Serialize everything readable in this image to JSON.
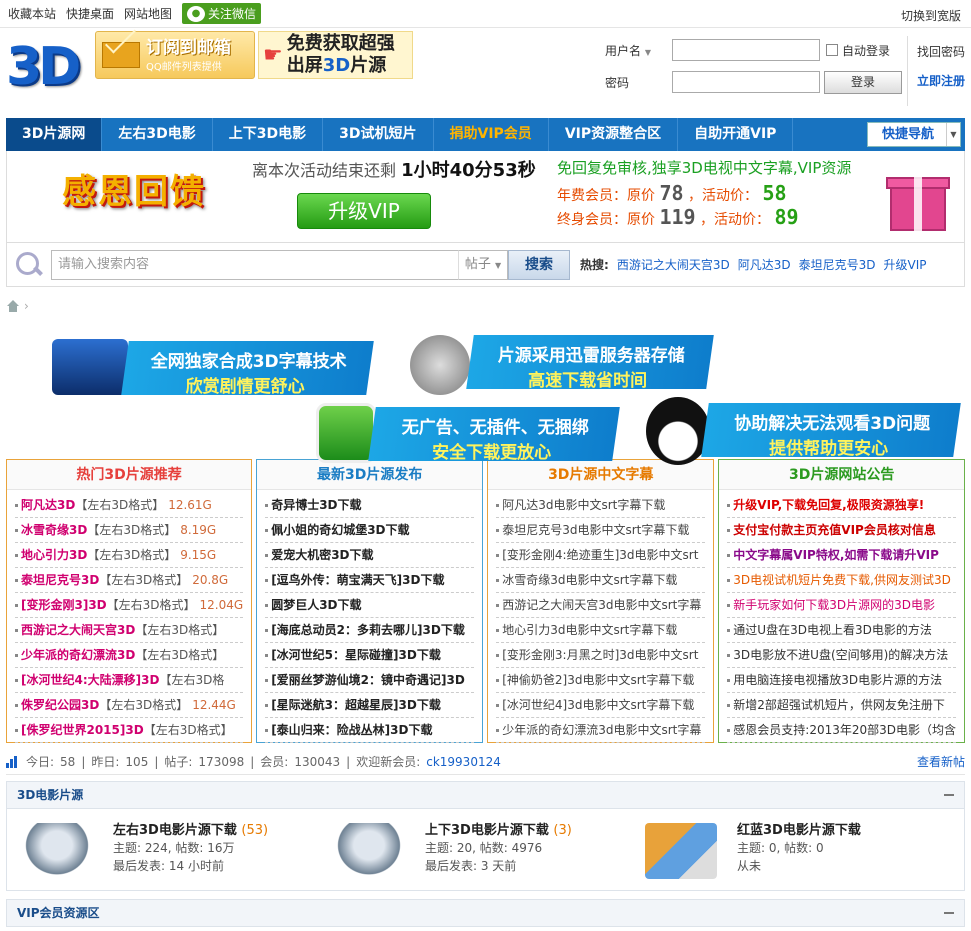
{
  "top": {
    "links": [
      "收藏本站",
      "快捷桌面",
      "网站地图"
    ],
    "wechat": "关注微信",
    "wide": "切换到宽版"
  },
  "header": {
    "logo": "3D",
    "mail_title": "订阅到邮箱",
    "mail_sub": "QQ邮件列表提供",
    "free_line1": "免费获取超强",
    "free_line2a": "出屏",
    "free_line2b": "3D",
    "free_line2c": "片源"
  },
  "login": {
    "user_label": "用户名",
    "pass_label": "密码",
    "auto": "自动登录",
    "btn": "登录",
    "forgot": "找回密码",
    "register": "立即注册"
  },
  "nav": {
    "items": [
      "3D片源网",
      "左右3D电影",
      "上下3D电影",
      "3D试机短片",
      "捐助VIP会员",
      "VIP资源整合区",
      "自助开通VIP"
    ],
    "quick": "快捷导航"
  },
  "banner": {
    "title": "感恩回馈",
    "countdown_pre": "离本次活动结束还剩",
    "countdown": "1小时40分53秒",
    "upgrade": "升级VIP",
    "promo": "免回复免审核,独享3D电视中文字幕,VIP资源",
    "year_label": "年费会员：原价",
    "year_orig": "78",
    "year_act_label": "，活动价：",
    "year_act": "58",
    "life_label": "终身会员：原价",
    "life_orig": "119",
    "life_act_label": "，活动价：",
    "life_act": "89"
  },
  "search": {
    "placeholder": "请输入搜索内容",
    "type": "帖子",
    "btn": "搜索",
    "hot_label": "热搜:",
    "hot": [
      "西游记之大闹天宫3D",
      "阿凡达3D",
      "泰坦尼克号3D",
      "升级VIP"
    ]
  },
  "promos": [
    {
      "l1": "全网独家合成3D字幕技术",
      "l2": "欣赏剧情更舒心"
    },
    {
      "l1": "片源采用迅雷服务器存储",
      "l2": "高速下载省时间"
    },
    {
      "l1": "无广告、无插件、无捆绑",
      "l2": "安全下载更放心"
    },
    {
      "l1": "协助解决无法观看3D问题",
      "l2": "提供帮助更安心"
    }
  ],
  "panels": [
    {
      "title": "热门3D片源推荐",
      "items": [
        [
          "阿凡达3D",
          "【左右3D格式】",
          "12.61G"
        ],
        [
          "冰雪奇缘3D",
          "【左右3D格式】",
          "8.19G"
        ],
        [
          "地心引力3D",
          "【左右3D格式】",
          "9.15G"
        ],
        [
          "泰坦尼克号3D",
          "【左右3D格式】",
          "20.8G"
        ],
        [
          "[变形金刚3]3D",
          "【左右3D格式】",
          "12.04G"
        ],
        [
          "西游记之大闹天宫3D",
          "【左右3D格式】",
          ""
        ],
        [
          "少年派的奇幻漂流3D",
          "【左右3D格式】",
          ""
        ],
        [
          "[冰河世纪4:大陆漂移]3D",
          "【左右3D格",
          ""
        ],
        [
          "侏罗纪公园3D",
          "【左右3D格式】",
          "12.44G"
        ],
        [
          "[侏罗纪世界2015]3D",
          "【左右3D格式】",
          ""
        ]
      ]
    },
    {
      "title": "最新3D片源发布",
      "items": [
        "奇异博士3D下载",
        "佩小姐的奇幻城堡3D下载",
        "爱宠大机密3D下载",
        "[逗鸟外传：萌宝满天飞]3D下载",
        "圆梦巨人3D下载",
        "[海底总动员2：多莉去哪儿]3D下载",
        "[冰河世纪5：星际碰撞]3D下载",
        "[爱丽丝梦游仙境2：镜中奇遇记]3D",
        "[星际迷航3：超越星辰]3D下载",
        "[泰山归来：险战丛林]3D下载"
      ]
    },
    {
      "title": "3D片源中文字幕",
      "items": [
        "阿凡达3d电影中文srt字幕下载",
        "泰坦尼克号3d电影中文srt字幕下载",
        "[变形金刚4:绝迹重生]3d电影中文srt",
        "冰雪奇缘3d电影中文srt字幕下载",
        "西游记之大闹天宫3d电影中文srt字幕",
        "地心引力3d电影中文srt字幕下载",
        "[变形金刚3:月黑之时]3d电影中文srt",
        "[神偷奶爸2]3d电影中文srt字幕下载",
        "[冰河世纪4]3d电影中文srt字幕下载",
        "少年派的奇幻漂流3d电影中文srt字幕"
      ]
    },
    {
      "title": "3D片源网站公告",
      "items": [
        "升级VIP,下载免回复,极限资源独享!",
        "支付宝付款主页充值VIP会员核对信息",
        "中文字幕属VIP特权,如需下载请升VIP",
        "3D电视试机短片免费下载,供网友测试3D",
        "新手玩家如何下载3D片源网的3D电影",
        "通过U盘在3D电视上看3D电影的方法",
        "3D电影放不进U盘(空间够用)的解决方法",
        "用电脑连接电视播放3D电影片源的方法",
        "新增2部超强试机短片，供网友免注册下",
        "感恩会员支持:2013年20部3D电影（均含"
      ]
    }
  ],
  "stats": {
    "today_label": "今日:",
    "today": "58",
    "yest_label": "昨日:",
    "yest": "105",
    "posts_label": "帖子:",
    "posts": "173098",
    "members_label": "会员:",
    "members": "130043",
    "welcome": "欢迎新会员:",
    "newmember": "ck19930124",
    "view_new": "查看新帖"
  },
  "section1": {
    "title": "3D电影片源",
    "forums": [
      {
        "name": "左右3D电影片源下载",
        "count": "(53)",
        "stat": "主题: 224, 帖数: 16万",
        "last": "最后发表: 14 小时前"
      },
      {
        "name": "上下3D电影片源下载",
        "count": "(3)",
        "stat": "主题: 20, 帖数: 4976",
        "last": "最后发表: 3 天前"
      },
      {
        "name": "红蓝3D电影片源下载",
        "count": "",
        "stat": "主题: 0, 帖数: 0",
        "last": "从未"
      }
    ]
  },
  "section2": {
    "title": "VIP会员资源区"
  },
  "colors": {
    "nav": "#1873c0",
    "accent": "#1660c8",
    "orange": "#e9a33a",
    "blue": "#49a3d4",
    "green": "#6ab14a"
  }
}
